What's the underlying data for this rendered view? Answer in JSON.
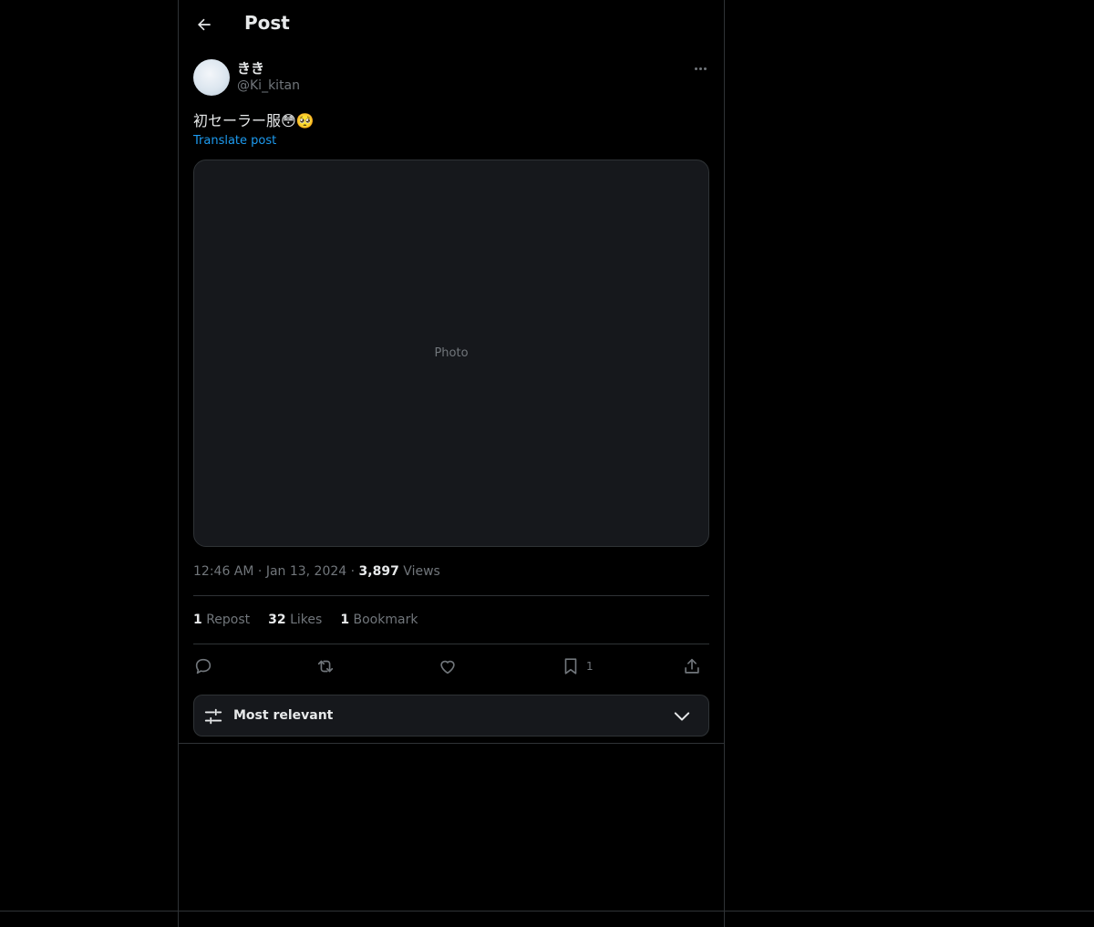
{
  "header": {
    "title": "Post"
  },
  "author": {
    "name": "きき",
    "handle": "@Ki_kitan"
  },
  "post": {
    "text": "初セーラー服😳🥺",
    "translate_label": "Translate post",
    "media_label": "Photo"
  },
  "meta": {
    "time": "12:46 AM",
    "date": "Jan 13, 2024",
    "views_count": "3,897",
    "views_label": "Views"
  },
  "stats": {
    "reposts_count": "1",
    "reposts_label": "Repost",
    "likes_count": "32",
    "likes_label": "Likes",
    "bookmarks_count": "1",
    "bookmarks_label": "Bookmark"
  },
  "actions": {
    "bookmark_count": "1"
  },
  "sort": {
    "label": "Most relevant"
  },
  "icons": [
    "back-arrow-icon",
    "more-icon",
    "reply-icon",
    "repost-icon",
    "like-icon",
    "bookmark-icon",
    "share-icon",
    "sliders-icon",
    "chevron-down-icon"
  ],
  "colors": {
    "background": "#000000",
    "text": "#e7e9ea",
    "muted": "#71767b",
    "accent": "#1d9bf0",
    "border": "#2f3336",
    "panel": "#16181c"
  }
}
